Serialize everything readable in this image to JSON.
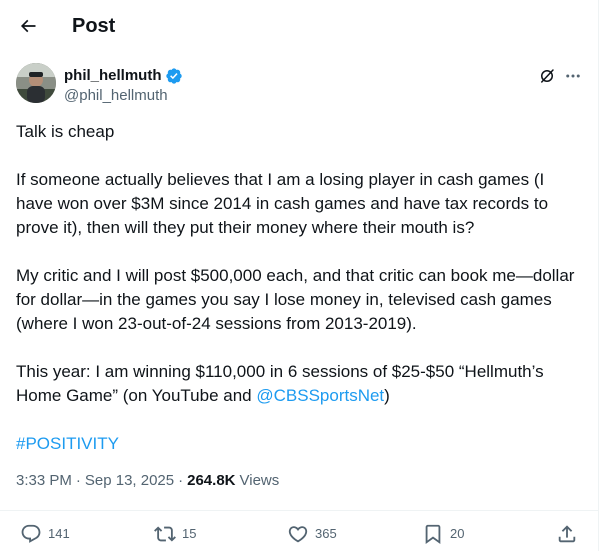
{
  "header": {
    "title": "Post"
  },
  "author": {
    "display_name": "phil_hellmuth",
    "handle": "@phil_hellmuth"
  },
  "tweet": {
    "p1": "Talk is cheap",
    "p2": "If someone actually believes that I am a losing player in cash games (I have won over $3M since 2014 in cash games and have tax records to prove it), then will they put their money where their mouth is?",
    "p3": "My critic and I will post $500,000 each, and that critic can book me—dollar for dollar—in the games you say I lose money in, televised cash games (where I won 23-out-of-24 sessions from 2013-2019).",
    "p4_before": "This year: I am winning $110,000 in 6 sessions of $25-$50 “Hellmuth’s Home Game” (on YouTube and ",
    "p4_mention": "@CBSSportsNet",
    "p4_after": ")",
    "hashtag": "#POSITIVITY"
  },
  "meta": {
    "time": "3:33 PM",
    "separator1": "·",
    "date": "Sep 13, 2025",
    "separator2": "·",
    "views_count": "264.8K",
    "views_label": "Views"
  },
  "actions": {
    "replies": "141",
    "reposts": "15",
    "likes": "365",
    "bookmarks": "20"
  },
  "colors": {
    "accent": "#1d9bf0",
    "text": "#0f1419",
    "muted": "#536471"
  },
  "icons": [
    "back-arrow-icon",
    "verified-badge-icon",
    "grok-icon",
    "more-icon",
    "reply-icon",
    "repost-icon",
    "like-icon",
    "bookmark-icon",
    "share-icon"
  ]
}
